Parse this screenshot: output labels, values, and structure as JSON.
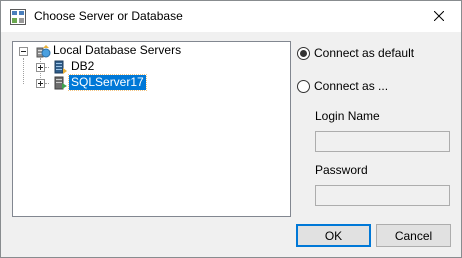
{
  "window": {
    "title": "Choose Server or Database",
    "close_glyph": "✕"
  },
  "tree": {
    "root": {
      "label": "Local Database Servers",
      "icon": "server-group-icon",
      "expanded": true
    },
    "children": [
      {
        "label": "DB2",
        "icon": "db2-server-icon",
        "expanded": false,
        "selected": false
      },
      {
        "label": "SQLServer17",
        "icon": "sqlserver-icon",
        "expanded": false,
        "selected": true
      }
    ]
  },
  "connection": {
    "default_label": "Connect as default",
    "as_label": "Connect as ...",
    "selected": "default",
    "login_label": "Login Name",
    "login_value": "",
    "password_label": "Password",
    "password_value": ""
  },
  "buttons": {
    "ok": "OK",
    "cancel": "Cancel"
  },
  "colors": {
    "selection": "#0078d7",
    "dialog_bg": "#f0f0f0"
  }
}
